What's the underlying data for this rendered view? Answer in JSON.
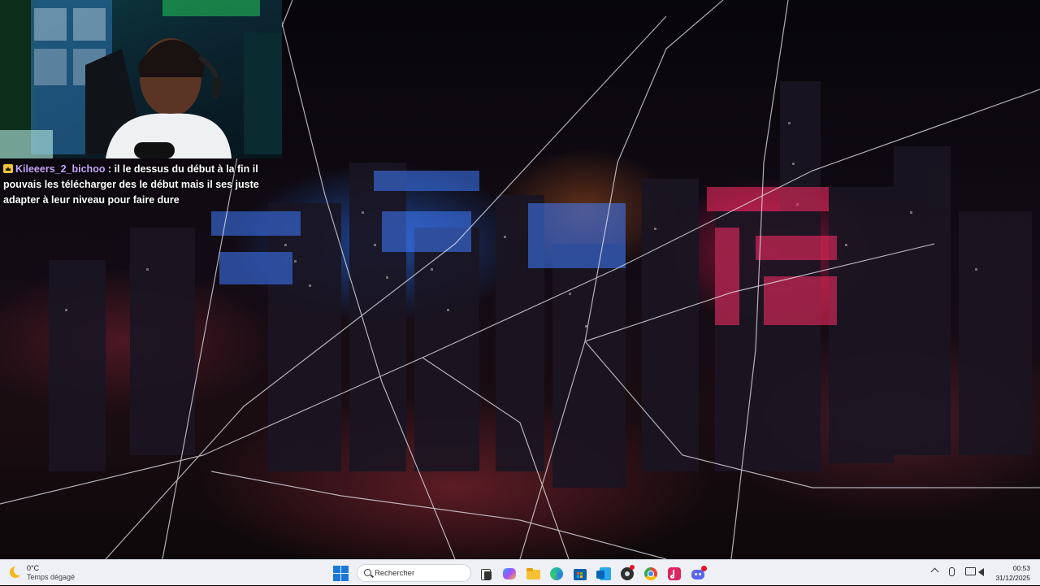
{
  "chat": {
    "username": "Kileeers_2_bichoo",
    "message": " : il le dessus du début à la fin il pouvais les télécharger des le début mais il ses juste adapter à leur niveau pour faire dure"
  },
  "taskbar": {
    "weather": {
      "temperature": "0°C",
      "condition": "Temps dégagé",
      "icon": "moon-icon"
    },
    "search": {
      "placeholder": "Rechercher"
    },
    "apps": [
      {
        "name": "task-view-icon"
      },
      {
        "name": "copilot-icon"
      },
      {
        "name": "file-explorer-icon"
      },
      {
        "name": "edge-icon"
      },
      {
        "name": "microsoft-store-icon"
      },
      {
        "name": "outlook-icon"
      },
      {
        "name": "obs-icon"
      },
      {
        "name": "chrome-icon"
      },
      {
        "name": "tiktok-icon"
      },
      {
        "name": "discord-icon",
        "badge": ""
      }
    ],
    "clock": {
      "time": "00:53",
      "date": "31/12/2025"
    }
  },
  "colors": {
    "taskbar_bg": "#eef0f6",
    "chat_username": "#c9a6ff",
    "windows_blue": "#1a78d8"
  }
}
